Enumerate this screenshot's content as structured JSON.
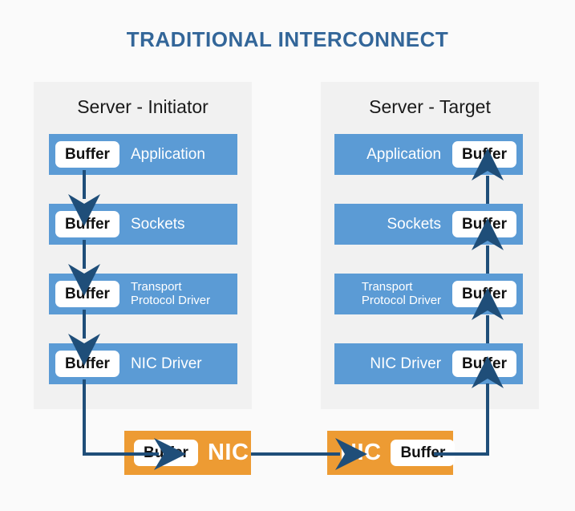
{
  "title": "TRADITIONAL INTERCONNECT",
  "colors": {
    "background": "#fafafa",
    "title": "#336699",
    "panel": "#f1f1f1",
    "layer_blue": "#5b9bd5",
    "nic_orange": "#ed9b33",
    "arrow_navy": "#1f4e79",
    "buffer_fill": "#ffffff"
  },
  "buffer_label": "Buffer",
  "initiator": {
    "panel_title": "Server - Initiator",
    "layers": [
      {
        "label": "Application",
        "buffer": "Buffer"
      },
      {
        "label": "Sockets",
        "buffer": "Buffer"
      },
      {
        "label": "Transport\nProtocol Driver",
        "buffer": "Buffer"
      },
      {
        "label": "NIC Driver",
        "buffer": "Buffer"
      }
    ],
    "nic": {
      "label": "NIC",
      "buffer": "Buffer"
    }
  },
  "target": {
    "panel_title": "Server - Target",
    "layers": [
      {
        "label": "Application",
        "buffer": "Buffer"
      },
      {
        "label": "Sockets",
        "buffer": "Buffer"
      },
      {
        "label": "Transport\nProtocol Driver",
        "buffer": "Buffer"
      },
      {
        "label": "NIC Driver",
        "buffer": "Buffer"
      }
    ],
    "nic": {
      "label": "NIC",
      "buffer": "Buffer"
    }
  }
}
